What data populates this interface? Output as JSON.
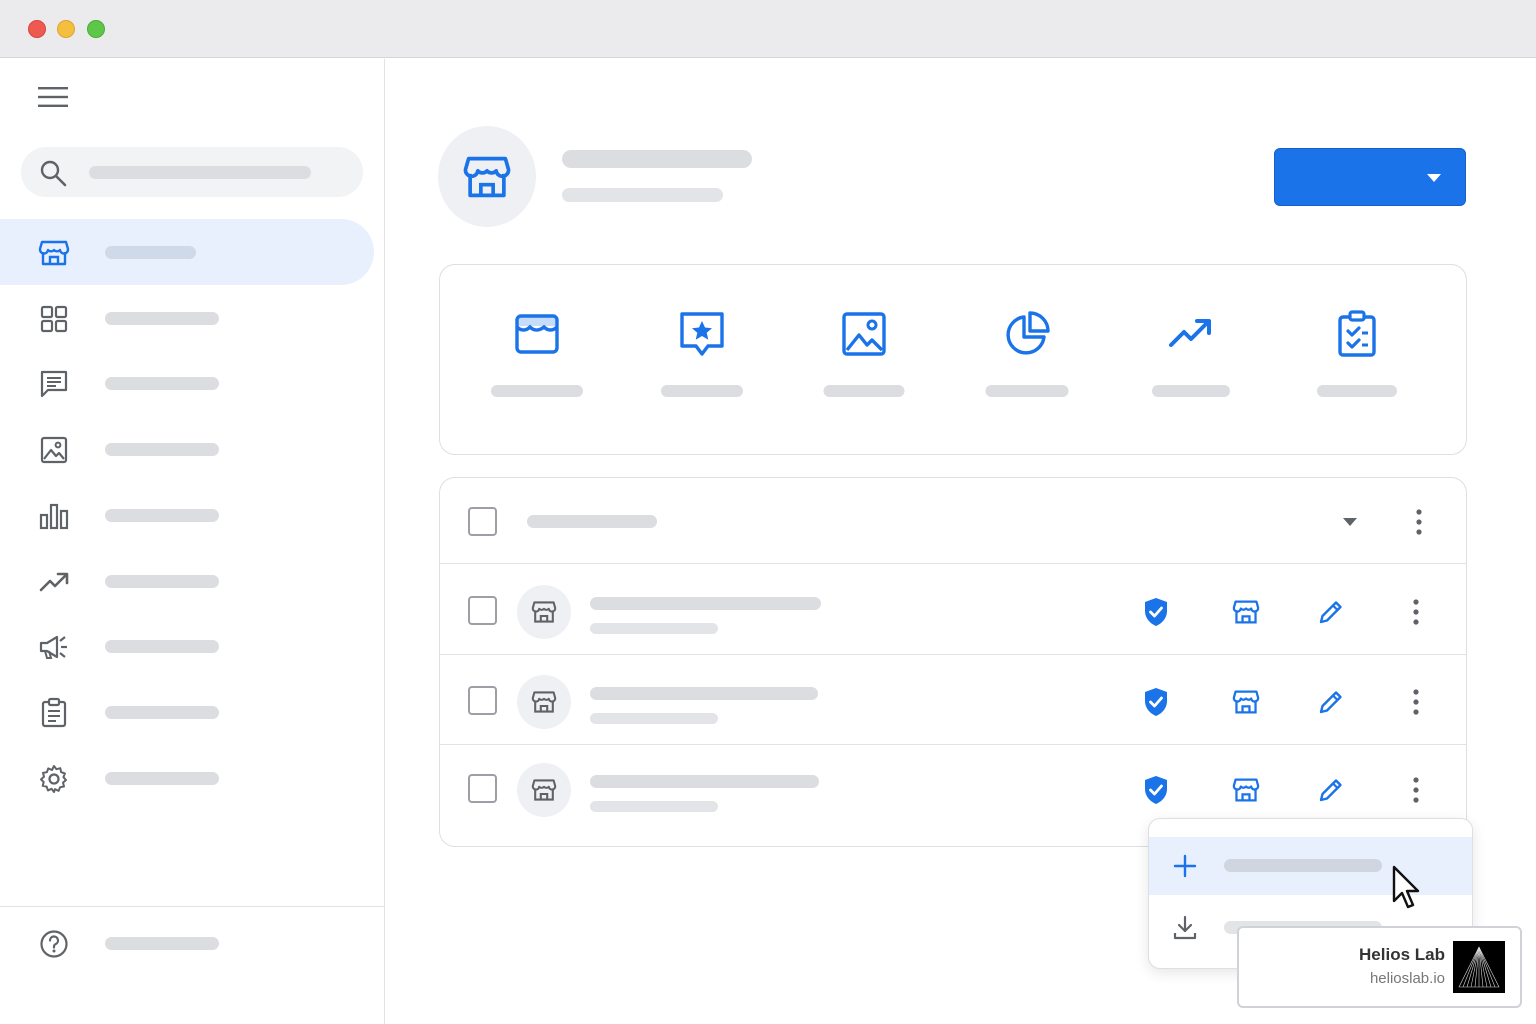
{
  "colors": {
    "accent": "#1a73e8",
    "active_nav_bg": "#e8f0fe",
    "placeholder_gray": "#dcdde0",
    "icon_gray": "#5f6368"
  },
  "window": {
    "controls": [
      "close",
      "minimize",
      "maximize"
    ]
  },
  "sidebar": {
    "menu_icon": "hamburger-icon",
    "search_icon": "search-icon",
    "items": [
      {
        "icon": "storefront-icon",
        "active": true
      },
      {
        "icon": "grid-icon",
        "active": false
      },
      {
        "icon": "message-icon",
        "active": false
      },
      {
        "icon": "image-icon",
        "active": false
      },
      {
        "icon": "bar-chart-icon",
        "active": false
      },
      {
        "icon": "trending-up-icon",
        "active": false
      },
      {
        "icon": "megaphone-icon",
        "active": false
      },
      {
        "icon": "clipboard-icon",
        "active": false
      },
      {
        "icon": "gear-icon",
        "active": false
      }
    ],
    "help_icon": "help-icon"
  },
  "header": {
    "avatar_icon": "storefront-icon",
    "primary_action_icon": "caret-down-icon"
  },
  "features": [
    {
      "icon": "storefront-icon"
    },
    {
      "icon": "review-star-icon"
    },
    {
      "icon": "image-icon"
    },
    {
      "icon": "pie-chart-icon"
    },
    {
      "icon": "trending-up-icon"
    },
    {
      "icon": "clipboard-check-icon"
    }
  ],
  "table": {
    "rows": [
      {
        "actions": [
          "verified-shield-icon",
          "storefront-icon",
          "pencil-icon",
          "more-vertical-icon"
        ]
      },
      {
        "actions": [
          "verified-shield-icon",
          "storefront-icon",
          "pencil-icon",
          "more-vertical-icon"
        ]
      },
      {
        "actions": [
          "verified-shield-icon",
          "storefront-icon",
          "pencil-icon",
          "more-vertical-icon"
        ]
      }
    ]
  },
  "menu": {
    "items": [
      {
        "icon": "plus-icon",
        "hovered": true
      },
      {
        "icon": "download-icon",
        "hovered": false
      }
    ]
  },
  "brand": {
    "name": "Helios Lab",
    "url": "helioslab.io"
  }
}
